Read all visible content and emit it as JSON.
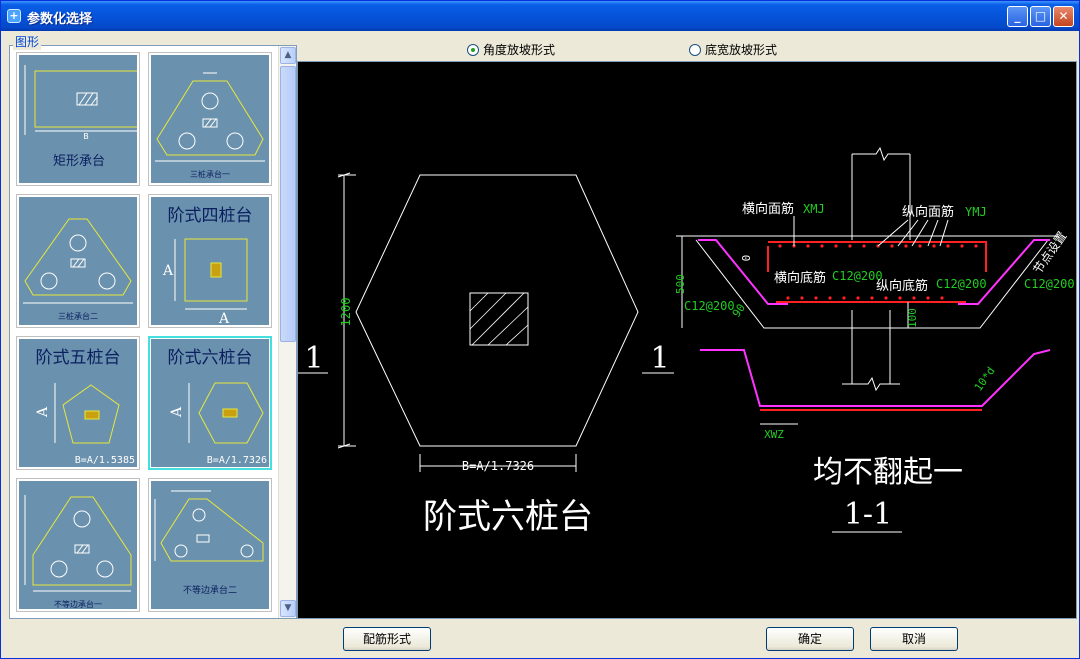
{
  "window": {
    "title": "参数化选择",
    "min_glyph": "_",
    "max_glyph": "□",
    "close_glyph": "✕"
  },
  "gallery": {
    "group_label": "图形",
    "thumbs": [
      {
        "name": "rect-cap",
        "caption": "矩形承台",
        "dim1": "B"
      },
      {
        "name": "three-pile-1",
        "caption": "三桩承台一"
      },
      {
        "name": "three-pile-2",
        "caption": "三桩承台二"
      },
      {
        "name": "step-four",
        "caption": "阶式四桩台",
        "dim1": "A",
        "dim2": "A"
      },
      {
        "name": "step-five",
        "caption": "阶式五桩台",
        "dim1": "A",
        "formula": "B=A/1.5385"
      },
      {
        "name": "step-six",
        "caption": "阶式六桩台",
        "dim1": "A",
        "formula": "B=A/1.7326"
      },
      {
        "name": "unequal-1",
        "caption": "不等边承台一"
      },
      {
        "name": "unequal-2",
        "caption": "不等边承台二"
      }
    ]
  },
  "options": {
    "angle_label": "角度放坡形式",
    "width_label": "底宽放坡形式",
    "selected": "angle"
  },
  "drawing": {
    "dim_height": "1200",
    "dim_width": "B=A/1.7326",
    "section_mark": "1",
    "title": "阶式六桩台",
    "label_top_x": "横向面筋",
    "code_top_x": "XMJ",
    "label_top_y": "纵向面筋",
    "code_top_y": "YMJ",
    "label_bot_x": "横向底筋",
    "code_bot_x": "C12@200",
    "label_bot_y": "纵向底筋",
    "code_bot_y": "C12@200",
    "side_code_left": "C12@200",
    "side_code_right": "C12@200",
    "side_label": "节点设置",
    "dim_500": "500",
    "dim_0": "0",
    "dim_100": "100",
    "angle_90": "90",
    "dim_10d": "10*d",
    "code_xwz": "XWZ",
    "note": "均不翻起一",
    "section_title": "1-1"
  },
  "buttons": {
    "rebar": "配筋形式",
    "ok": "确定",
    "cancel": "取消"
  },
  "colors": {
    "title_bar": "#0553d9",
    "thumb_bg": "#6a91ad",
    "canvas_bg": "#000000",
    "rebar_red": "#ff2020",
    "magenta": "#ff33ff",
    "cad_green": "#22cc22"
  }
}
